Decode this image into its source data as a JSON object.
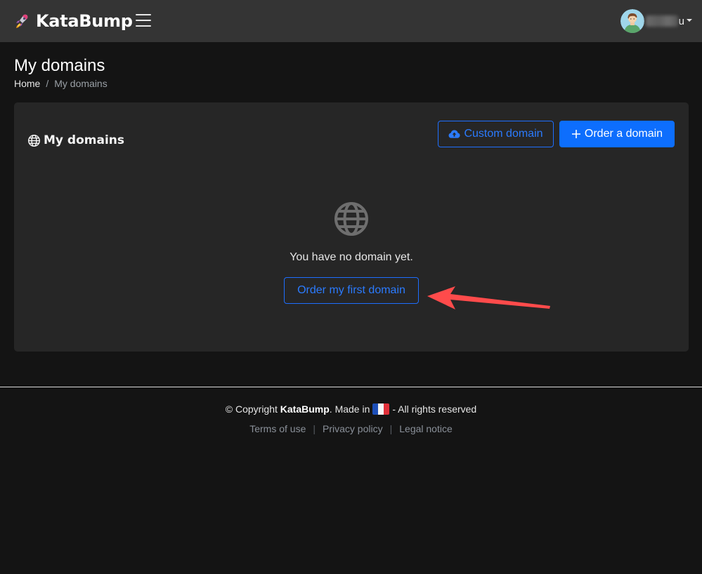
{
  "navbar": {
    "brand": "KataBump",
    "username_suffix": "u"
  },
  "page": {
    "title": "My domains",
    "breadcrumb": {
      "home": "Home",
      "separator": "/",
      "current": "My domains"
    }
  },
  "card": {
    "title": "My domains",
    "custom_domain_label": "Custom domain",
    "order_domain_label": "Order a domain",
    "empty_text": "You have no domain yet.",
    "first_domain_label": "Order my first domain"
  },
  "footer": {
    "copyright_prefix": "© Copyright ",
    "brand": "KataBump",
    "made_in": ". Made in",
    "rights": "- All rights reserved",
    "links": [
      "Terms of use",
      "Privacy policy",
      "Legal notice"
    ],
    "link_separator": "|"
  },
  "colors": {
    "accent": "#0d6efd",
    "navbar_bg": "#343434",
    "page_bg": "#141414",
    "card_bg": "#262626",
    "annotation_arrow": "#ff4b4b"
  },
  "icons": {
    "brand": "rocket-icon",
    "menu": "hamburger-icon",
    "card_title": "globe-icon",
    "custom_domain": "cloud-upload-icon",
    "order_domain": "plus-icon",
    "empty_state": "globe-icon",
    "footer_flag": "france-flag-icon"
  }
}
